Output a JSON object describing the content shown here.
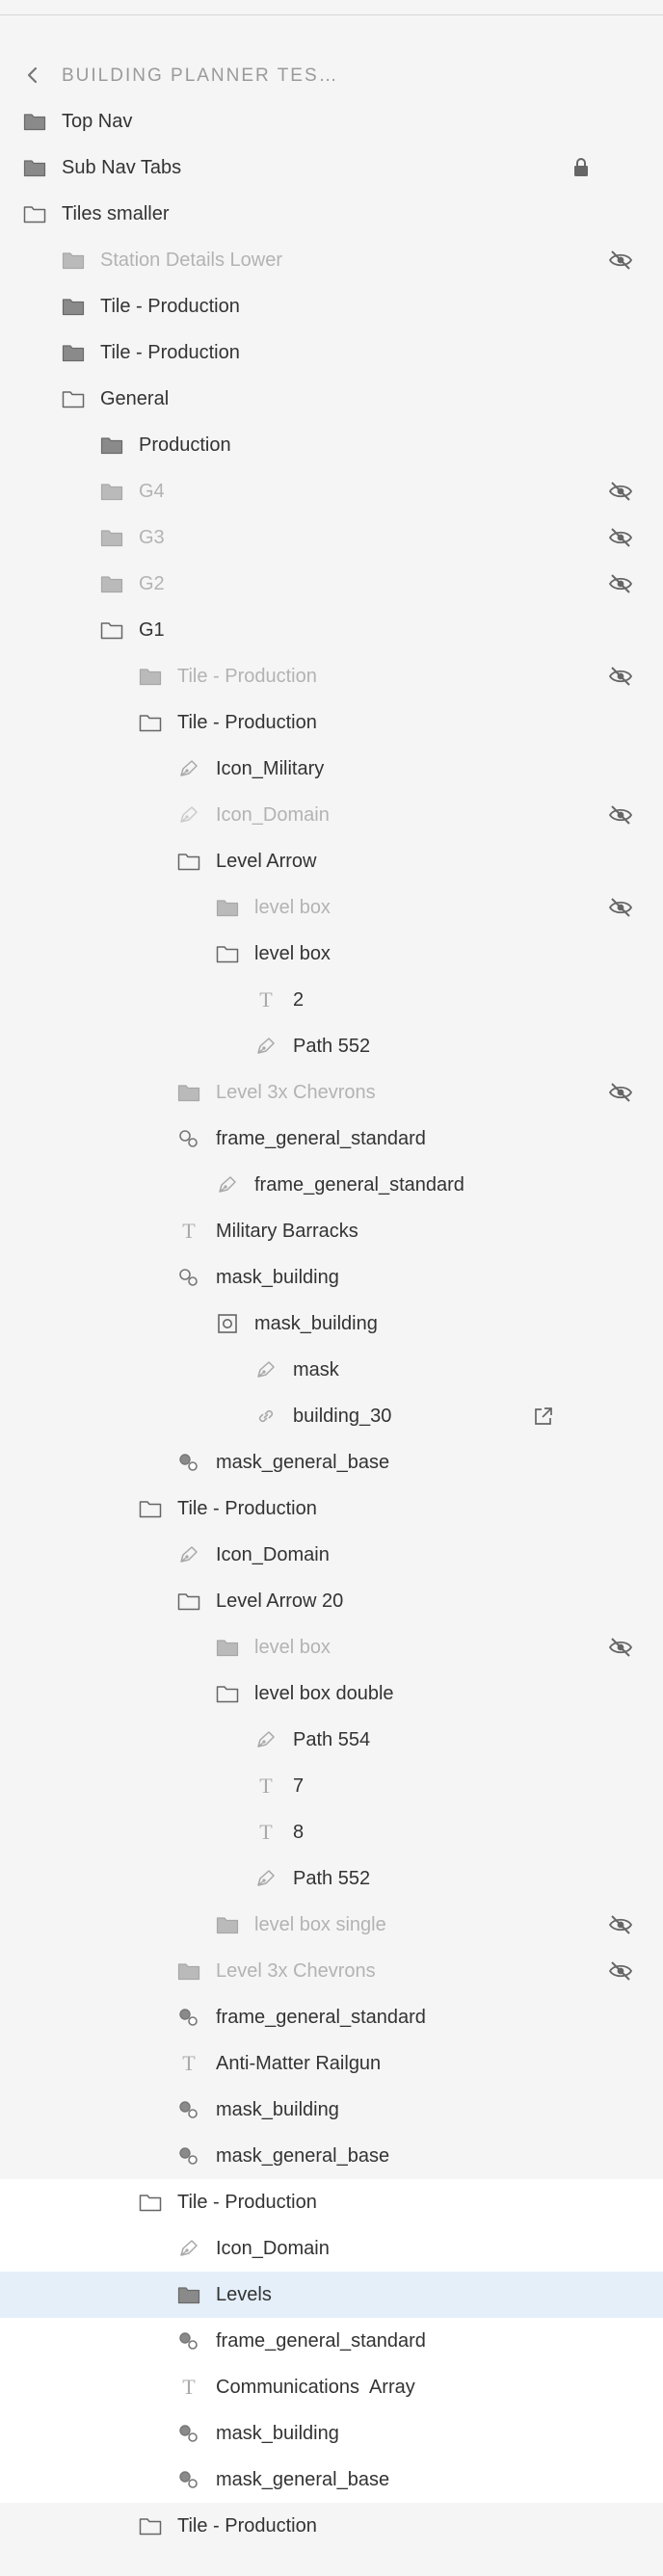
{
  "panel": {
    "title": "BUILDING PLANNER TES…",
    "back_icon": "chevron-left-icon"
  },
  "colors": {
    "background": "#f5f5f5",
    "selected_row": "#e4eff9",
    "highlight_rows": "#ffffff",
    "text": "#333333",
    "hidden_text": "#b3b3b3"
  },
  "layers": [
    {
      "label": "Top Nav",
      "type": "folder-filled",
      "depth": 0
    },
    {
      "label": "Sub Nav Tabs",
      "type": "folder-filled",
      "depth": 0,
      "locked": true
    },
    {
      "label": "Tiles smaller",
      "type": "folder-open",
      "depth": 0
    },
    {
      "label": "Station Details Lower",
      "type": "folder-filled",
      "depth": 1,
      "hidden": true
    },
    {
      "label": "Tile - Production",
      "type": "folder-filled",
      "depth": 1
    },
    {
      "label": "Tile - Production",
      "type": "folder-filled",
      "depth": 1
    },
    {
      "label": "General",
      "type": "folder-open",
      "depth": 1
    },
    {
      "label": "Production",
      "type": "folder-filled",
      "depth": 2
    },
    {
      "label": "G4",
      "type": "folder-filled",
      "depth": 2,
      "hidden": true
    },
    {
      "label": "G3",
      "type": "folder-filled",
      "depth": 2,
      "hidden": true
    },
    {
      "label": "G2",
      "type": "folder-filled",
      "depth": 2,
      "hidden": true
    },
    {
      "label": "G1",
      "type": "folder-open",
      "depth": 2
    },
    {
      "label": "Tile - Production",
      "type": "folder-filled",
      "depth": 3,
      "hidden": true
    },
    {
      "label": "Tile - Production",
      "type": "folder-open",
      "depth": 3
    },
    {
      "label": "Icon_Military",
      "type": "path",
      "depth": 4
    },
    {
      "label": "Icon_Domain",
      "type": "path",
      "depth": 4,
      "hidden": true
    },
    {
      "label": "Level Arrow",
      "type": "folder-open",
      "depth": 4
    },
    {
      "label": "level box",
      "type": "folder-filled",
      "depth": 5,
      "hidden": true
    },
    {
      "label": "level box",
      "type": "folder-open",
      "depth": 5
    },
    {
      "label": "2",
      "type": "text",
      "depth": 6
    },
    {
      "label": "Path 552",
      "type": "path",
      "depth": 6
    },
    {
      "label": "Level 3x Chevrons",
      "type": "folder-filled",
      "depth": 4,
      "hidden": true
    },
    {
      "label": "frame_general_standard",
      "type": "mask-outline",
      "depth": 4
    },
    {
      "label": "frame_general_standard",
      "type": "path",
      "depth": 5
    },
    {
      "label": "Military Barracks",
      "type": "text",
      "depth": 4
    },
    {
      "label": "mask_building",
      "type": "mask-outline",
      "depth": 4
    },
    {
      "label": "mask_building",
      "type": "symbol",
      "depth": 5
    },
    {
      "label": "mask",
      "type": "path",
      "depth": 6
    },
    {
      "label": "building_30",
      "type": "link",
      "depth": 6,
      "external": true
    },
    {
      "label": "mask_general_base",
      "type": "mask-filled",
      "depth": 4
    },
    {
      "label": "Tile - Production",
      "type": "folder-open",
      "depth": 3
    },
    {
      "label": "Icon_Domain",
      "type": "path",
      "depth": 4
    },
    {
      "label": "Level Arrow 20",
      "type": "folder-open",
      "depth": 4
    },
    {
      "label": "level box",
      "type": "folder-filled",
      "depth": 5,
      "hidden": true
    },
    {
      "label": "level box double",
      "type": "folder-open",
      "depth": 5
    },
    {
      "label": "Path 554",
      "type": "path",
      "depth": 6
    },
    {
      "label": "7",
      "type": "text",
      "depth": 6
    },
    {
      "label": "8",
      "type": "text",
      "depth": 6
    },
    {
      "label": "Path 552",
      "type": "path",
      "depth": 6
    },
    {
      "label": "level box single",
      "type": "folder-filled",
      "depth": 5,
      "hidden": true
    },
    {
      "label": "Level 3x Chevrons",
      "type": "folder-filled",
      "depth": 4,
      "hidden": true
    },
    {
      "label": "frame_general_standard",
      "type": "mask-filled",
      "depth": 4
    },
    {
      "label": "Anti-Matter Railgun",
      "type": "text",
      "depth": 4
    },
    {
      "label": "mask_building",
      "type": "mask-filled",
      "depth": 4
    },
    {
      "label": "mask_general_base",
      "type": "mask-filled",
      "depth": 4
    },
    {
      "label": "Tile - Production",
      "type": "folder-open",
      "depth": 3,
      "highlight": true
    },
    {
      "label": "Icon_Domain",
      "type": "path",
      "depth": 4,
      "highlight": true
    },
    {
      "label": "Levels",
      "type": "folder-filled",
      "depth": 4,
      "selected": true
    },
    {
      "label": "frame_general_standard",
      "type": "mask-filled",
      "depth": 4,
      "highlight": true
    },
    {
      "label": "Communications  Array",
      "type": "text",
      "depth": 4,
      "highlight": true
    },
    {
      "label": "mask_building",
      "type": "mask-filled",
      "depth": 4,
      "highlight": true
    },
    {
      "label": "mask_general_base",
      "type": "mask-filled",
      "depth": 4,
      "highlight": true
    },
    {
      "label": "Tile - Production",
      "type": "folder-open",
      "depth": 3
    }
  ]
}
